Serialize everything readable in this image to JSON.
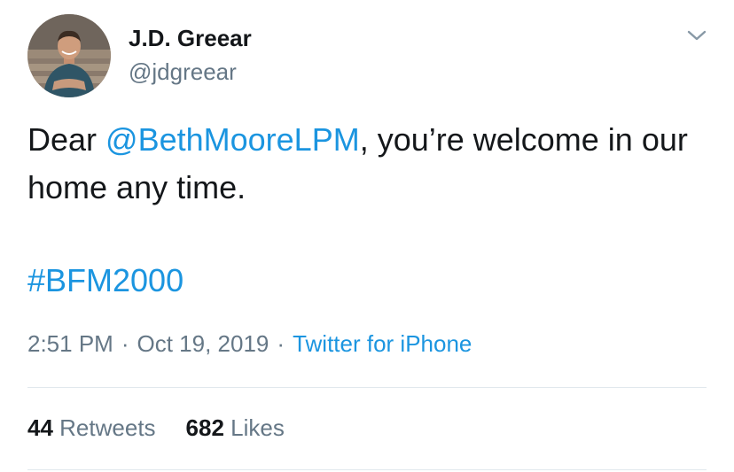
{
  "author": {
    "display_name": "J.D. Greear",
    "handle": "@jdgreear"
  },
  "tweet": {
    "text_prefix": "Dear ",
    "mention": "@BethMooreLPM",
    "text_suffix": ", you’re welcome in our home any time.",
    "hashtag": "#BFM2000"
  },
  "meta": {
    "time": "2:51 PM",
    "separator": "·",
    "date": "Oct 19, 2019",
    "source": "Twitter for iPhone"
  },
  "stats": {
    "retweets_count": "44",
    "retweets_label": "Retweets",
    "likes_count": "682",
    "likes_label": "Likes"
  },
  "colors": {
    "link": "#1b95e0",
    "secondary_text": "#657786",
    "primary_text": "#14171a",
    "divider": "#e1e8ed"
  },
  "icons": {
    "menu": "chevron-down-icon"
  }
}
